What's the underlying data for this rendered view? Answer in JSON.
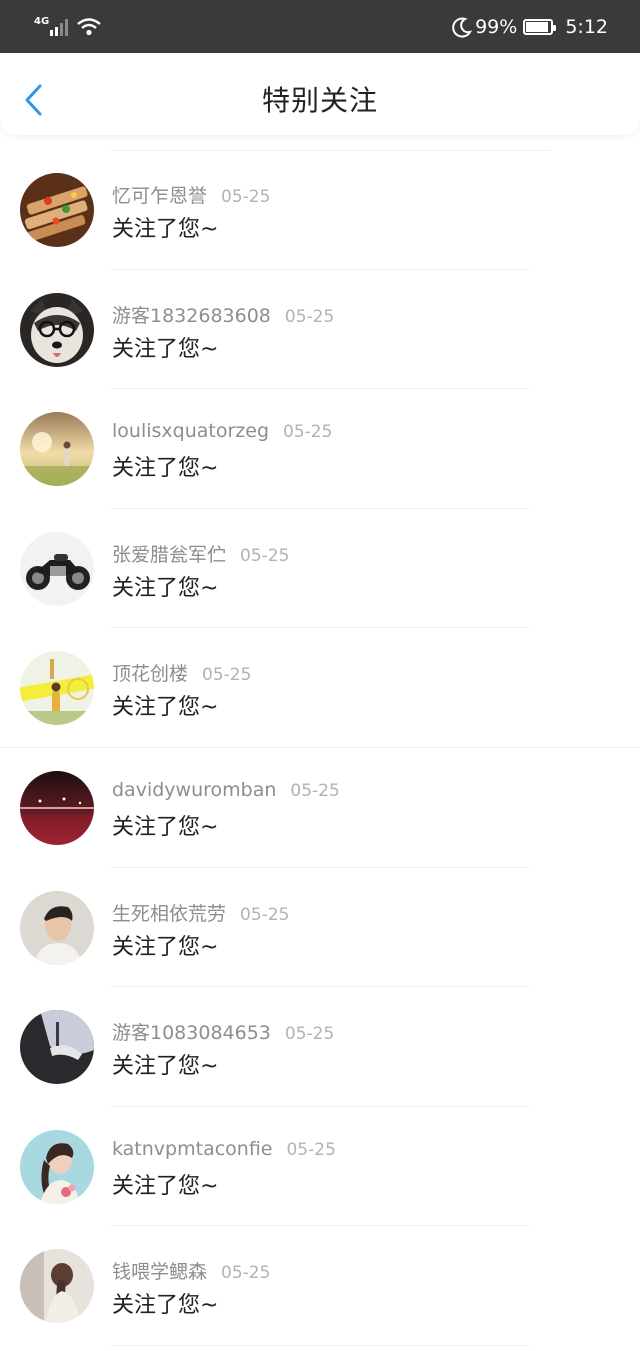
{
  "status_bar": {
    "network": "4G",
    "battery_percent": "99%",
    "battery_level": 0.99,
    "time": "5:12",
    "icons": [
      "signal-icon",
      "wifi-icon",
      "moon-icon",
      "battery-icon"
    ]
  },
  "header": {
    "title": "特别关注",
    "back_icon": "chevron-left-icon",
    "accent_color": "#2f95e5"
  },
  "items": [
    {
      "name": "忆可乍恩誉",
      "date": "05-25",
      "message": "关注了您~",
      "avatar": "food-grill-avatar"
    },
    {
      "name": "游客1832683608",
      "date": "05-25",
      "message": "关注了您~",
      "avatar": "husky-dog-avatar"
    },
    {
      "name": "loulisxquatorzeg",
      "date": "05-25",
      "message": "关注了您~",
      "avatar": "sunset-field-avatar"
    },
    {
      "name": "张爱腊瓮军伫",
      "date": "05-25",
      "message": "关注了您~",
      "avatar": "motorcycle-avatar"
    },
    {
      "name": "顶花创楼",
      "date": "05-25",
      "message": "关注了您~",
      "avatar": "fairground-avatar"
    },
    {
      "name": "davidywuromban",
      "date": "05-25",
      "message": "关注了您~",
      "avatar": "night-city-avatar"
    },
    {
      "name": "生死相依荒劳",
      "date": "05-25",
      "message": "关注了您~",
      "avatar": "young-man-avatar"
    },
    {
      "name": "游客1083084653",
      "date": "05-25",
      "message": "关注了您~",
      "avatar": "dark-hand-avatar"
    },
    {
      "name": "katnvpmtaconfie",
      "date": "05-25",
      "message": "关注了您~",
      "avatar": "girl-braid-avatar"
    },
    {
      "name": "钱喂学鳃森",
      "date": "05-25",
      "message": "关注了您~",
      "avatar": "girl-back-avatar"
    }
  ]
}
